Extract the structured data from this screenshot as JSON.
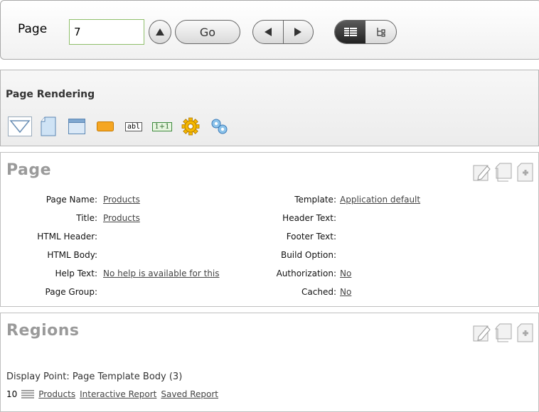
{
  "nav": {
    "page_label": "Page",
    "page_value": "7",
    "go_label": "Go"
  },
  "page_rendering": {
    "title": "Page Rendering",
    "icons": [
      "triangle-down-icon",
      "page-icon",
      "region-icon",
      "button-icon",
      "text-item-icon",
      "computation-icon",
      "gear-icon",
      "process-icon"
    ],
    "text_item_text": "abl",
    "computation_text": "1+1"
  },
  "page_section": {
    "title": "Page",
    "fields_left": [
      {
        "label": "Page Name:",
        "value": "Products"
      },
      {
        "label": "Title:",
        "value": "Products"
      },
      {
        "label": "HTML Header:",
        "value": ""
      },
      {
        "label": "HTML Body:",
        "value": ""
      },
      {
        "label": "Help Text:",
        "value": "No help is available for this"
      },
      {
        "label": "Page Group:",
        "value": ""
      }
    ],
    "fields_right": [
      {
        "label": "Template:",
        "value": "Application default"
      },
      {
        "label": "Header Text:",
        "value": ""
      },
      {
        "label": "Footer Text:",
        "value": ""
      },
      {
        "label": "Build Option:",
        "value": ""
      },
      {
        "label": "Authorization:",
        "value": "No"
      },
      {
        "label": "Cached:",
        "value": "No"
      }
    ]
  },
  "regions_section": {
    "title": "Regions",
    "display_point": "Display Point: Page Template Body (3)",
    "row": {
      "sequence": "10",
      "name": "Products",
      "type": "Interactive Report",
      "template": "Saved Report"
    }
  },
  "colors": {
    "section_title": "#9a9a9a",
    "input_border": "#8fbf6a",
    "link": "#444444"
  }
}
